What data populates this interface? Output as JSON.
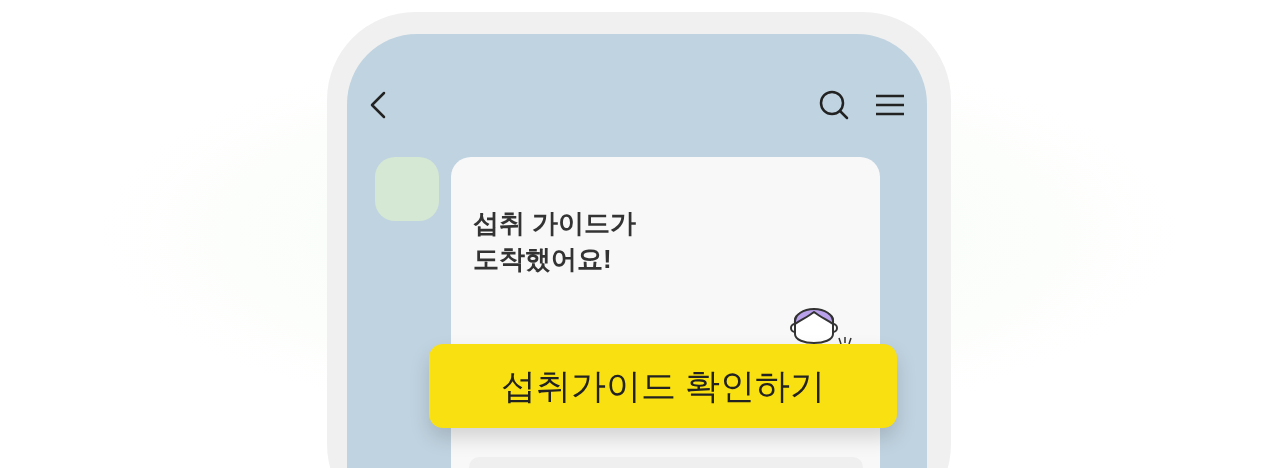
{
  "message_card": {
    "title_lines": [
      "섭취 가이드가",
      "도착했어요!"
    ]
  },
  "action_button": {
    "label": "섭취가이드 확인하기"
  }
}
